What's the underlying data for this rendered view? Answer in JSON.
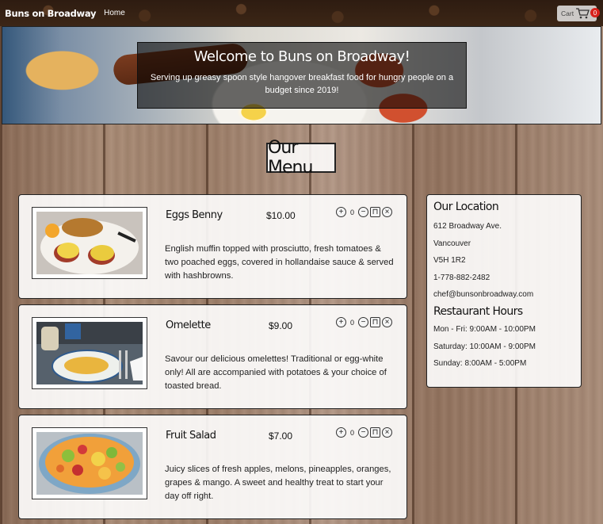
{
  "nav": {
    "brand": "Buns on Broadway",
    "home": "Home",
    "cart_label": "Cart",
    "cart_count": "0"
  },
  "hero": {
    "title": "Welcome to Buns on Broadway!",
    "subtitle": "Serving up greasy spoon style hangover breakfast food for hungry people on a budget since 2019!"
  },
  "menu": {
    "heading": "Our Menu",
    "items": [
      {
        "name": "Eggs Benny",
        "price": "$10.00",
        "qty": "0",
        "description": "English muffin topped with prosciutto, fresh tomatoes & two poached eggs, covered in hollandaise sauce & served with hashbrowns."
      },
      {
        "name": "Omelette",
        "price": "$9.00",
        "qty": "0",
        "description": "Savour our delicious omelettes! Traditional or egg-white only! All are accompanied with potatoes & your choice of toasted bread."
      },
      {
        "name": "Fruit Salad",
        "price": "$7.00",
        "qty": "0",
        "description": "Juicy slices of fresh apples, melons, pineapples, oranges, grapes & mango. A sweet and healthy treat to start your day off right."
      }
    ]
  },
  "sidebar": {
    "location_heading": "Our Location",
    "location_lines": [
      "612 Broadway Ave.",
      "Vancouver",
      "V5H 1R2",
      "1-778-882-2482",
      "chef@bunsonbroadway.com"
    ],
    "hours_heading": "Restaurant Hours",
    "hours_lines": [
      "Mon - Fri: 9:00AM - 10:00PM",
      "Saturday: 10:00AM - 9:00PM",
      "Sunday: 8:00AM - 5:00PM"
    ]
  },
  "colors": {
    "cart_badge": "#d9221c",
    "card_background": "#ffffff",
    "nav_background": "#3c2616"
  }
}
